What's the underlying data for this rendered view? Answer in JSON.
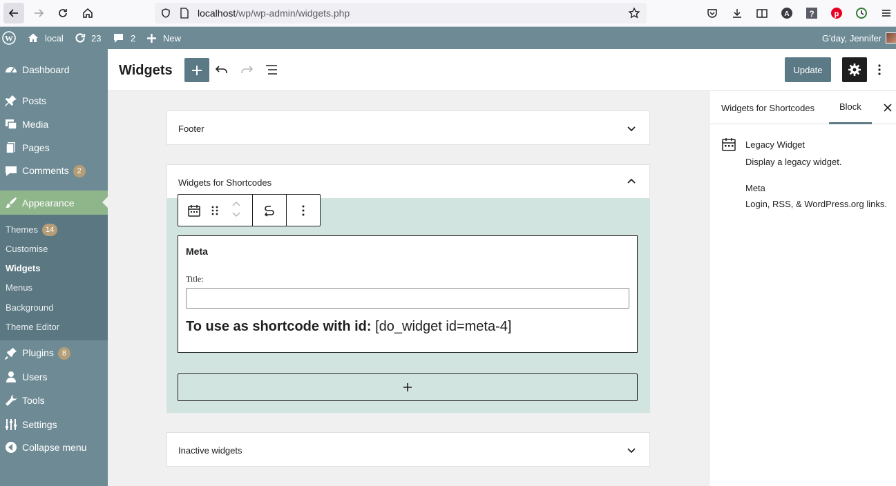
{
  "browser": {
    "url_host": "localhost",
    "url_path": "/wp/wp-admin/widgets.php"
  },
  "admin_bar": {
    "site_name": "local",
    "updates_count": "23",
    "comments_count": "2",
    "new_label": "New",
    "greeting": "G'day, Jennifer"
  },
  "sidebar": {
    "items": [
      {
        "label": "Dashboard",
        "icon": "dashboard-icon"
      },
      {
        "label": "Posts",
        "icon": "pin-icon"
      },
      {
        "label": "Media",
        "icon": "media-icon"
      },
      {
        "label": "Pages",
        "icon": "pages-icon"
      },
      {
        "label": "Comments",
        "icon": "comment-icon",
        "count": "2"
      },
      {
        "label": "Appearance",
        "icon": "brush-icon"
      },
      {
        "label": "Plugins",
        "icon": "plugin-icon",
        "count": "8"
      },
      {
        "label": "Users",
        "icon": "user-icon"
      },
      {
        "label": "Tools",
        "icon": "wrench-icon"
      },
      {
        "label": "Settings",
        "icon": "settings-icon"
      },
      {
        "label": "Collapse menu",
        "icon": "collapse-icon"
      }
    ],
    "submenu": [
      {
        "label": "Themes",
        "count": "14"
      },
      {
        "label": "Customise"
      },
      {
        "label": "Widgets"
      },
      {
        "label": "Menus"
      },
      {
        "label": "Background"
      },
      {
        "label": "Theme Editor"
      }
    ]
  },
  "header": {
    "title": "Widgets",
    "update_label": "Update"
  },
  "canvas": {
    "areas": [
      {
        "title": "Footer"
      },
      {
        "title": "Widgets for Shortcodes"
      },
      {
        "title": "Inactive widgets"
      }
    ],
    "widget": {
      "name": "Meta",
      "field_label": "Title:",
      "field_value": "",
      "shortcode_label": "To use as shortcode with id:",
      "shortcode_value": " [do_widget id=meta-4]"
    }
  },
  "panel": {
    "tabs": [
      "Widgets for Shortcodes",
      "Block"
    ],
    "active_tab": "Block",
    "block_title": "Legacy Widget",
    "block_description": "Display a legacy widget.",
    "widget_name": "Meta",
    "widget_description": "Login, RSS, & WordPress.org links."
  },
  "colors": {
    "admin_primary": "#6e8b95",
    "admin_dark": "#5b7782",
    "highlight": "#8fb58a",
    "area_selected": "#d2e4df",
    "badge": "#b59d77"
  }
}
